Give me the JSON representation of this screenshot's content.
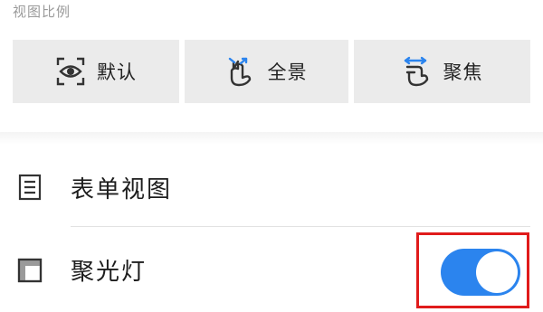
{
  "section": {
    "title": "视图比例"
  },
  "view_ratio": {
    "options": [
      {
        "label": "默认",
        "icon": "eye-frame-icon"
      },
      {
        "label": "全景",
        "icon": "pinch-out-hand-icon"
      },
      {
        "label": "聚焦",
        "icon": "spread-hand-icon"
      }
    ]
  },
  "settings": {
    "form_view": {
      "label": "表单视图",
      "icon": "form-list-icon"
    },
    "spotlight": {
      "label": "聚光灯",
      "icon": "spotlight-grid-icon",
      "enabled": true
    }
  },
  "colors": {
    "toggle_on": "#2b84ee",
    "highlight": "#e01b1b",
    "accent_icon": "#2b84ee"
  }
}
